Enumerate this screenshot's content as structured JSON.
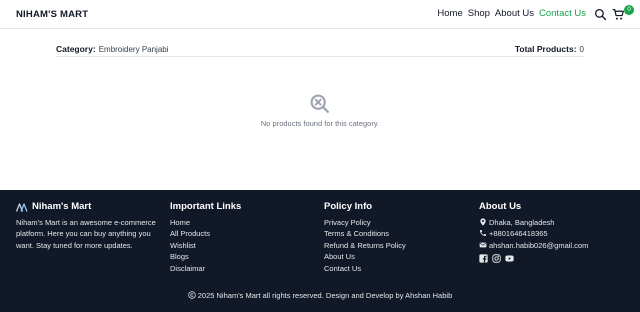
{
  "header": {
    "brand": "NIHAM'S MART",
    "nav": [
      {
        "label": "Home"
      },
      {
        "label": "Shop"
      },
      {
        "label": "About Us"
      },
      {
        "label": "Contact Us"
      }
    ],
    "cart_count": "0",
    "colors": {
      "accent": "#16a34a"
    }
  },
  "category_bar": {
    "category_label": "Category:",
    "category_value": "Embroidery Panjabi",
    "total_label": "Total Products:",
    "total_value": "0"
  },
  "empty_state": {
    "icon": "search-x-icon",
    "message": "No products found for this category."
  },
  "footer": {
    "about": {
      "title": "Niham's Mart",
      "description": "Niham's Mart is an awesome e-commerce platform. Here you can buy anything you want. Stay tuned for more updates."
    },
    "important_links": {
      "title": "Important Links",
      "items": [
        "Home",
        "All Products",
        "Wishlist",
        "Blogs",
        "Disclaimar"
      ]
    },
    "policy_info": {
      "title": "Policy Info",
      "items": [
        "Privacy Policy",
        "Terms & Conditions",
        "Refund & Returns Policy",
        "About Us",
        "Contact Us"
      ]
    },
    "about_us": {
      "title": "About Us",
      "location": "Dhaka, Bangladesh",
      "phone": "+8801646418365",
      "email": "ahshan.habib026@gmail.com"
    },
    "copyright": "2025 Niham's Mart all rights reserved. Design and Develop by Ahshan Habib",
    "background": "#111827"
  }
}
